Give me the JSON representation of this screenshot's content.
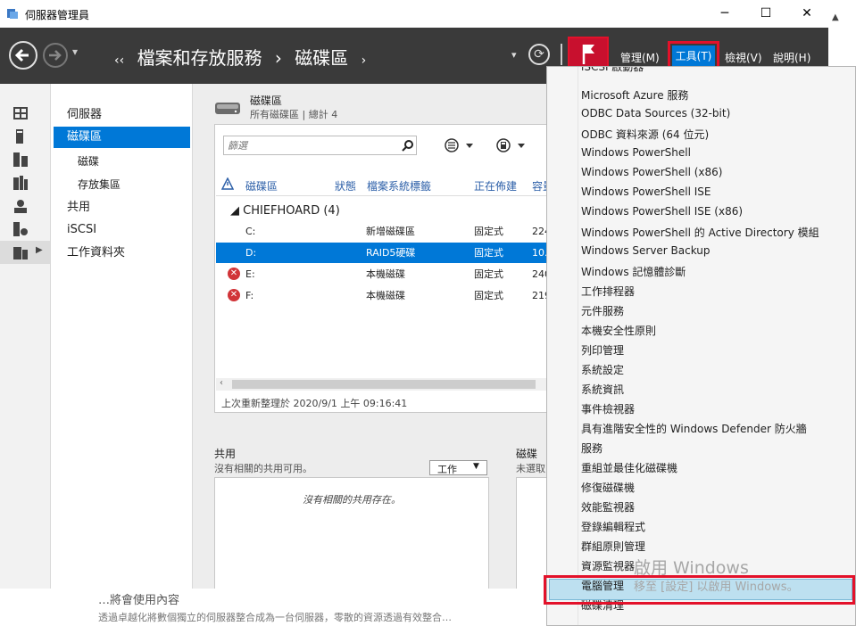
{
  "window": {
    "title": "伺服器管理員",
    "minimize": "─",
    "maximize": "☐",
    "close": "✕"
  },
  "header": {
    "crumbs": [
      "‹‹",
      "檔案和存放服務",
      "›",
      "磁碟區",
      "›"
    ],
    "menus": [
      "管理(M)",
      "工具(T)",
      "檢視(V)",
      "說明(H)"
    ],
    "dropdown_arrow": "▾",
    "refresh_icon": "⟳"
  },
  "nav": {
    "items": [
      {
        "label": "伺服器"
      },
      {
        "label": "磁碟區"
      },
      {
        "label": "磁碟"
      },
      {
        "label": "存放集區"
      },
      {
        "label": "共用"
      },
      {
        "label": "iSCSI"
      },
      {
        "label": "工作資料夾"
      }
    ],
    "icons": [
      "dashboard-icon",
      "server-icon",
      "servers-icon",
      "volumes-icon",
      "network-icon",
      "iscsi-icon",
      "folder-icon"
    ]
  },
  "volumes": {
    "title": "磁碟區",
    "subtitle": "所有磁碟區 | 總計 4",
    "filter_placeholder": "篩選",
    "columns": [
      "磁碟區",
      "狀態",
      "檔案系統標籤",
      "正在佈建",
      "容量"
    ],
    "group": "◢  CHIEFHOARD (4)",
    "rows": [
      {
        "volume": "C:",
        "status": "",
        "label": "新增磁碟區",
        "provisioning": "固定式",
        "capacity": "224",
        "error": false,
        "selected": false
      },
      {
        "volume": "D:",
        "status": "",
        "label": "RAID5硬碟",
        "provisioning": "固定式",
        "capacity": "10.",
        "error": false,
        "selected": true
      },
      {
        "volume": "E:",
        "status": "",
        "label": "本機磁碟",
        "provisioning": "固定式",
        "capacity": "240",
        "error": true,
        "selected": false
      },
      {
        "volume": "F:",
        "status": "",
        "label": "本機磁碟",
        "provisioning": "固定式",
        "capacity": "219",
        "error": true,
        "selected": false
      }
    ],
    "last_refresh": "上次重新整理於 2020/9/1 上午 09:16:41"
  },
  "shares": {
    "title": "共用",
    "subtitle": "沒有相關的共用可用。",
    "tasks_label": "工作",
    "empty_text": "沒有相關的共用存在。"
  },
  "disk": {
    "title": "磁碟",
    "subtitle": "未選取"
  },
  "tools_menu": {
    "items": [
      "iSCSI 啟動器",
      "Microsoft Azure 服務",
      "ODBC Data Sources (32-bit)",
      "ODBC 資料來源 (64 位元)",
      "Windows PowerShell",
      "Windows PowerShell (x86)",
      "Windows PowerShell ISE",
      "Windows PowerShell ISE (x86)",
      "Windows PowerShell 的 Active Directory 模組",
      "Windows Server Backup",
      "Windows 記憶體診斷",
      "工作排程器",
      "元件服務",
      "本機安全性原則",
      "列印管理",
      "系統設定",
      "系統資訊",
      "事件檢視器",
      "具有進階安全性的 Windows Defender 防火牆",
      "服務",
      "重組並最佳化磁碟機",
      "修復磁碟機",
      "效能監視器",
      "登錄編輯程式",
      "群組原則管理",
      "資源監視器",
      "電腦管理",
      "磁碟清理"
    ],
    "highlighted": "電腦管理"
  },
  "watermark": {
    "line1": "啟用 Windows",
    "line2": "移至 [設定] 以啟用 Windows。"
  },
  "background_text": {
    "line1": "…將會使用內容",
    "line2": "透過卓越化將數個獨立的伺服器整合成為一台伺服器，零散的資源透過有效整合…"
  },
  "colors": {
    "accent": "#0078d7",
    "header_bg": "#3a3a3a",
    "highlight_red": "#e3112a",
    "menu_highlight": "#bde0f0",
    "error": "#d13438"
  }
}
